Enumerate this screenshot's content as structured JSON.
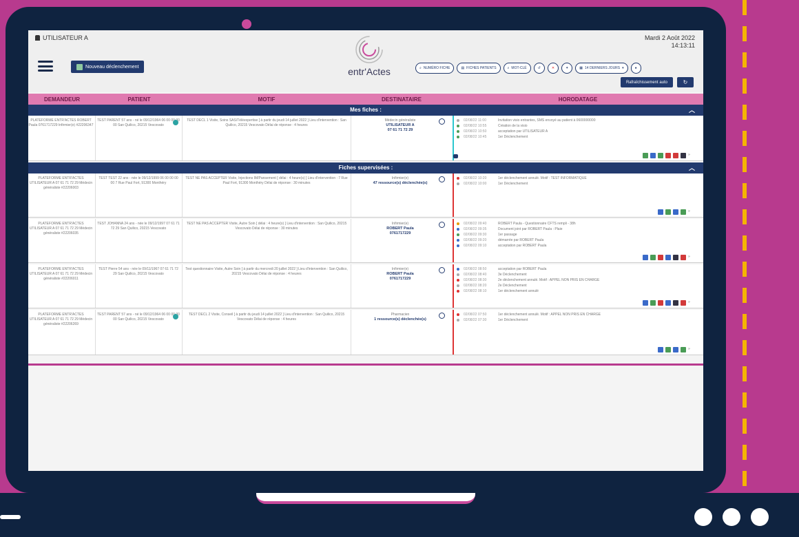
{
  "header": {
    "user": "UTILISATEUR A",
    "date": "Mardi 2 Août 2022",
    "time": "14:13:11",
    "new_button": "Nouveau déclenchement",
    "logo_text": "entr'Actes",
    "refresh_label": "Rafraîchissement auto",
    "tools": [
      {
        "label": "NUMÉRO FICHE",
        "icon": "search-icon"
      },
      {
        "label": "FICHES PATIENTS",
        "icon": "document-icon"
      },
      {
        "label": "MOT-CLÉ",
        "icon": "search-icon"
      },
      {
        "label": "",
        "icon": "history-icon"
      },
      {
        "label": "",
        "icon": "close-icon"
      },
      {
        "label": "",
        "icon": "pin-icon"
      },
      {
        "label": "14 DERNIERS JOURS",
        "icon": "calendar-icon"
      },
      {
        "label": "",
        "icon": "chat-icon"
      }
    ]
  },
  "columns": [
    "DEMANDEUR",
    "PATIENT",
    "MOTIF",
    "DESTINATAIRE",
    "HORODATAGE"
  ],
  "sections": {
    "mine": "Mes fiches :",
    "supervised": "Fiches supervisées :"
  },
  "rows": [
    {
      "demandeur": "PLATEFORME ENTR'ACTES ROBERT Paula 0761717229 Infirmier(e) #22206347",
      "patient": "TEST PARENT 57 ans - né le 09/12/1964 06 00 00 00 00 San Quilico, 20215 Vescovato",
      "motif": "TEST DECL 1 Visite, Soins SAS/Téléexpertise [ à partir du jeudi 14 juillet 2022 ] Lieu d'intervention : San Quilico, 20215 Vescovato Délai de réponse : 4 heures",
      "dest_role": "Médecin généraliste",
      "dest_name": "UTILISATEUR A",
      "dest_phone": "07 61 71 72 29",
      "events": [
        "Invitation visio entrantes, SMS envoyé au patient à 0600000000",
        "Création de la visio",
        "acceptation par UTILISATEUR A",
        "1er Déclenchement"
      ]
    },
    {
      "demandeur": "PLATEFORME ENTR'ACTES UTILISATEUR A 07 61 71 72 29 Médecin généraliste #22206003",
      "patient": "TEST TEST 22 ans - née le 09/12/1999 06 00 00 00 00 7 Rue Paul Fort, 91300 Monthéry",
      "motif": "TEST NE PAS ACCEPTER Visite, Injections IM/Pansement [ délai : 4 heure(s) ] Lieu d'intervention : 7 Rue Paul Fort, 91300 Monthéry Délai de réponse : 30 minutes",
      "dest_role": "Infirmier(e)",
      "dest_name": "47 ressource(s) déclenchée(s)",
      "dest_phone": "",
      "events": [
        "1er déclenchement annulé. Motif : TEST INFORMATIQUE",
        "1er Déclenchement"
      ]
    },
    {
      "demandeur": "PLATEFORME ENTR'ACTES UTILISATEUR A 07 61 71 72 29 Médecin généraliste #22206035",
      "patient": "TEST JOHANNA 24 ans - née le 09/12/1997 07 61 71 72 29 San Quilico, 20215 Vescovato",
      "motif": "TEST NE PAS ACCEPTER Visite, Autre Soin [ délai : 4 heure(s) ] Lieu d'intervention : San Quilico, 20215 Vescovato Délai de réponse : 30 minutes",
      "dest_role": "Infirmier(e)",
      "dest_name": "ROBERT Paula",
      "dest_phone": "0761717229",
      "events": [
        "ROBERT Paula - Questionnaire CFTS rempli - 38h",
        "Document joint par ROBERT Paula : Plaie",
        "1er passage",
        "démarrée par ROBERT Paula",
        "acceptation par ROBERT Paula"
      ]
    },
    {
      "demandeur": "PLATEFORME ENTR'ACTES UTILISATEUR A 07 61 71 72 29 Médecin généraliste #22206011",
      "patient": "TEST Pierre 54 ans - née le 09/11/1967 07 61 71 72 29 San Quilico, 20215 Vescovato",
      "motif": "Test questionnaire Visite, Autre Soin [ à partir du mercredi 20 juillet 2022 ] Lieu d'intervention : San Quilico, 20215 Vescovato Délai de réponse : 4 heures",
      "dest_role": "Infirmier(e)",
      "dest_name": "ROBERT Paula",
      "dest_phone": "0761717229",
      "events": [
        "acceptation par ROBERT Paula",
        "3e Déclenchement",
        "2e déclenchement annulé. Motif : APPEL NON PRIS EN CHARGE",
        "2e Déclenchement",
        "1er déclenchement annulé"
      ]
    },
    {
      "demandeur": "PLATEFORME ENTR'ACTES UTILISATEUR A 07 61 71 72 29 Médecin généraliste #22206269",
      "patient": "TEST PARENT 57 ans - né le 09/12/1964 06 00 00 00 00 San Quilico, 20215 Vescovato",
      "motif": "TEST DECL 2 Visite, Conseil [ à partir du jeudi 14 juillet 2022 ] Lieu d'intervention : San Quilico, 20215 Vescovato Délai de réponse : 4 heures",
      "dest_role": "Pharmacien",
      "dest_name": "1 ressource(s) déclenchée(s)",
      "dest_phone": "",
      "events": [
        "1er déclenchement annulé. Motif : APPEL NON PRIS EN CHARGE",
        "1er Déclenchement"
      ]
    }
  ],
  "colors": {
    "accent": "#b83a8e",
    "navy": "#223a6e",
    "header_pink": "#e07ab0",
    "alert_red": "#d33333",
    "ok_cyan": "#2ac7cf"
  }
}
